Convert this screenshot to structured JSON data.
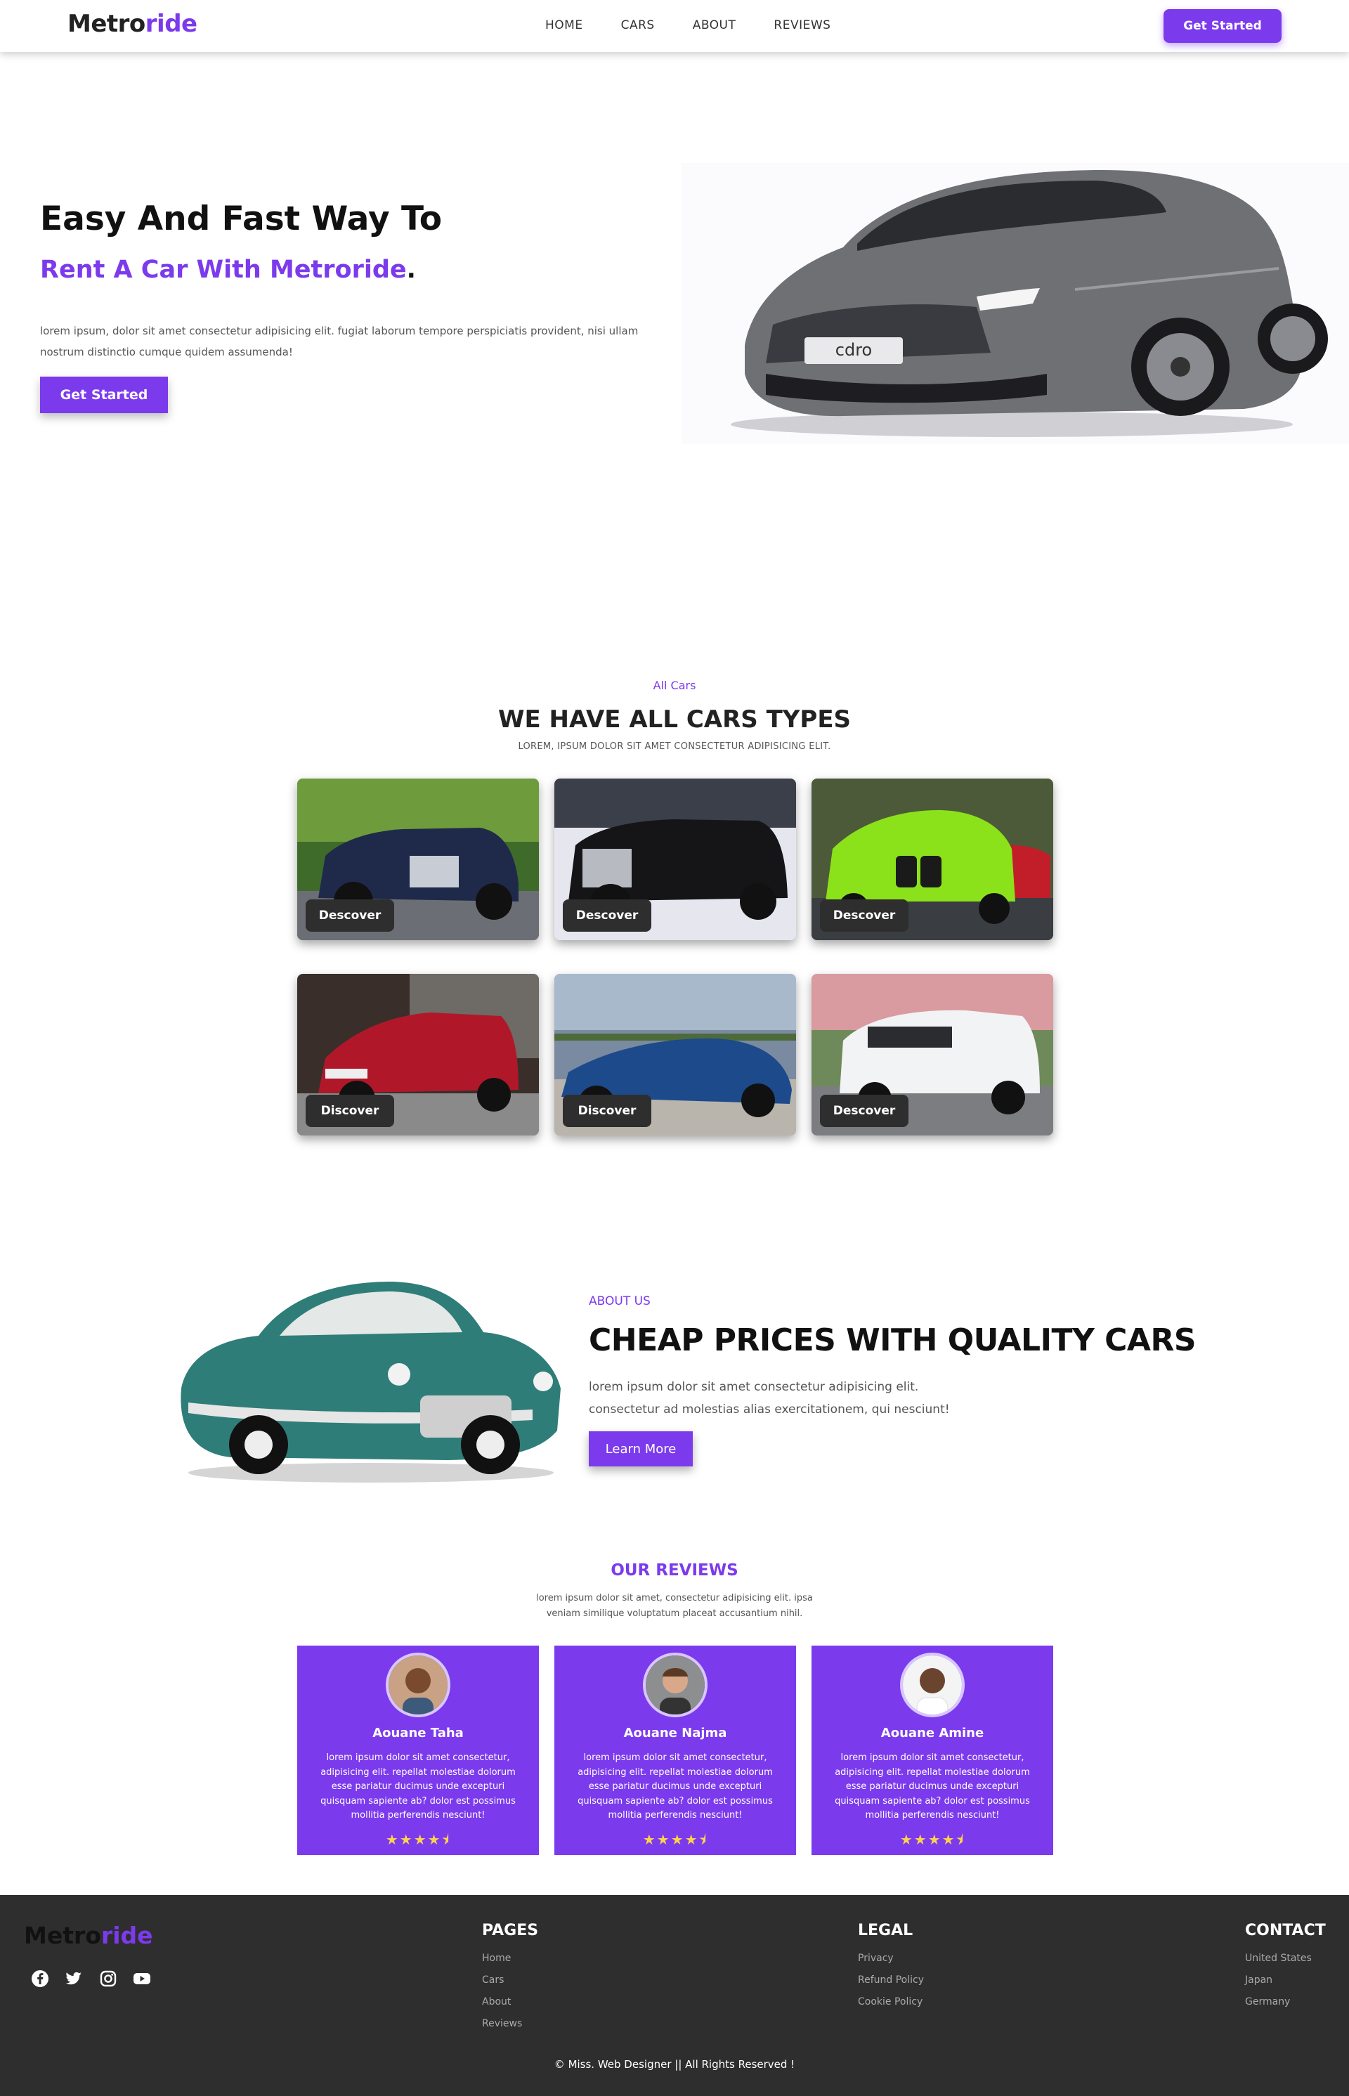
{
  "nav": {
    "logo_main": "Metro",
    "logo_accent": "ride",
    "links": [
      "HOME",
      "CARS",
      "ABOUT",
      "REVIEWS"
    ],
    "cta": "Get Started"
  },
  "hero": {
    "title": "Easy And Fast Way To",
    "subtitle": "Rent A Car With Metroride",
    "subtitle_dot": ".",
    "text": "lorem ipsum, dolor sit amet consectetur adipisicing elit. fugiat laborum tempore perspiciatis provident, nisi ullam nostrum distinctio cumque quidem assumenda!",
    "cta": "Get Started",
    "plate": "cdro"
  },
  "cars": {
    "kicker": "All Cars",
    "title": "WE HAVE ALL CARS TYPES",
    "description": "LOREM, IPSUM DOLOR SIT AMET CONSECTETUR ADIPISICING ELIT.",
    "cards": [
      {
        "button": "Descover"
      },
      {
        "button": "Descover"
      },
      {
        "button": "Descover"
      },
      {
        "button": "Discover"
      },
      {
        "button": "Discover"
      },
      {
        "button": "Descover"
      }
    ]
  },
  "about": {
    "kicker": "ABOUT US",
    "title": "CHEAP PRICES WITH QUALITY CARS",
    "text": "lorem ipsum dolor sit amet consectetur adipisicing elit. consectetur ad molestias alias exercitationem, qui nesciunt!",
    "cta": "Learn More"
  },
  "reviews": {
    "title": "OUR REVIEWS",
    "description": "lorem ipsum dolor sit amet, consectetur adipisicing elit. ipsa veniam similique voluptatum placeat accusantium nihil.",
    "items": [
      {
        "name": "Aouane Taha",
        "text": "lorem ipsum dolor sit amet consectetur, adipisicing elit. repellat molestiae dolorum esse pariatur ducimus unde excepturi quisquam sapiente ab? dolor est possimus mollitia perferendis nesciunt!",
        "rating": 4.5
      },
      {
        "name": "Aouane Najma",
        "text": "lorem ipsum dolor sit amet consectetur, adipisicing elit. repellat molestiae dolorum esse pariatur ducimus unde excepturi quisquam sapiente ab? dolor est possimus mollitia perferendis nesciunt!",
        "rating": 4.5
      },
      {
        "name": "Aouane Amine",
        "text": "lorem ipsum dolor sit amet consectetur, adipisicing elit. repellat molestiae dolorum esse pariatur ducimus unde excepturi quisquam sapiente ab? dolor est possimus mollitia perferendis nesciunt!",
        "rating": 4.5
      }
    ],
    "stars": "★★★★⯨"
  },
  "footer": {
    "logo_main": "Metro",
    "logo_accent": "ride",
    "social": [
      "facebook-icon",
      "twitter-icon",
      "instagram-icon",
      "youtube-icon"
    ],
    "pages_title": "PAGES",
    "pages": [
      "Home",
      "Cars",
      "About",
      "Reviews"
    ],
    "legal_title": "LEGAL",
    "legal": [
      "Privacy",
      "Refund Policy",
      "Cookie Policy"
    ],
    "contact_title": "CONTACT",
    "contact": [
      "United States",
      "Japan",
      "Germany"
    ],
    "copyright": "© Miss. Web Designer || All Rights Reserved !"
  },
  "colors": {
    "accent": "#7c3aed",
    "dark": "#2e2e2e",
    "star": "#fcd34d"
  }
}
